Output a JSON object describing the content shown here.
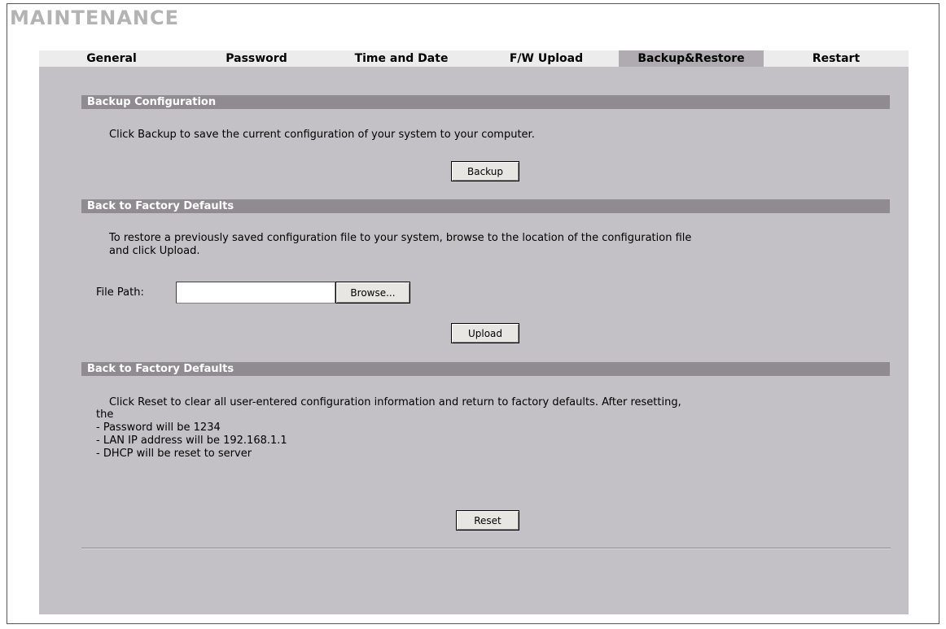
{
  "page": {
    "title": "MAINTENANCE"
  },
  "tabs": [
    {
      "label": "General"
    },
    {
      "label": "Password"
    },
    {
      "label": "Time and Date"
    },
    {
      "label": "F/W Upload"
    },
    {
      "label": "Backup&Restore",
      "active": true
    },
    {
      "label": "Restart"
    }
  ],
  "backup": {
    "header": "Backup Configuration",
    "description": "Click Backup to save the current configuration of your system to your computer.",
    "button": "Backup"
  },
  "restore": {
    "header": "Back to Factory Defaults",
    "description_line1": "To restore a previously saved configuration file to your system, browse to the location of the configuration file",
    "description_line2": "and click Upload.",
    "file_path_label": "File Path:",
    "file_path_value": "",
    "browse_button": "Browse...",
    "upload_button": "Upload"
  },
  "reset": {
    "header": "Back to Factory Defaults",
    "lines": [
      "Click Reset to clear all user-entered configuration information and return to factory defaults. After resetting,",
      "the",
      "- Password will be 1234",
      "- LAN IP address will be 192.168.1.1",
      "- DHCP will be reset to server"
    ],
    "button": "Reset"
  },
  "colors": {
    "panel_bg": "#c3c0c6",
    "section_bar": "#8f8b90",
    "active_tab": "#b0abb0",
    "title_gray": "#b3b3b3"
  }
}
